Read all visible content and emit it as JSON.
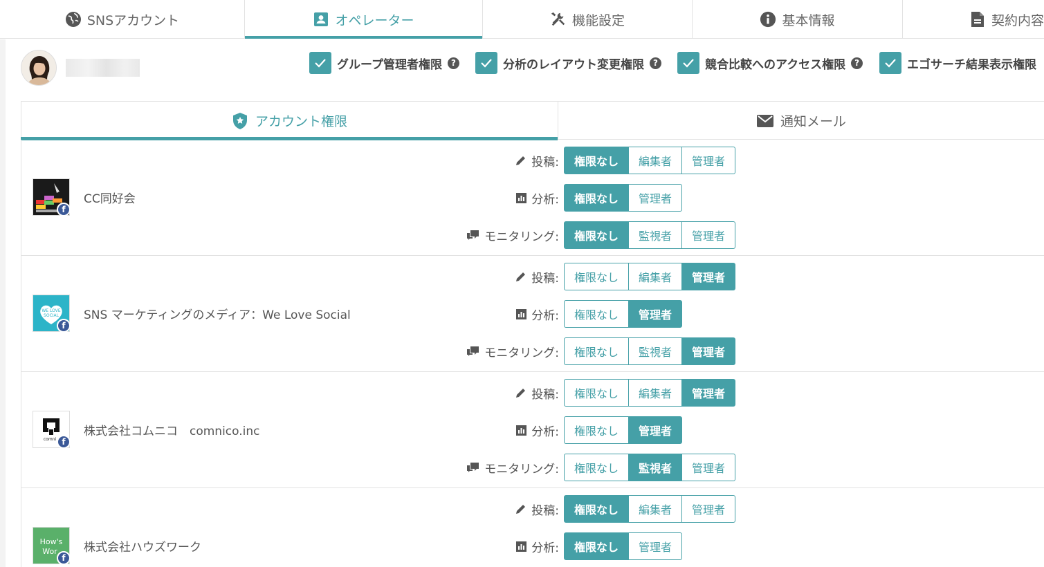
{
  "top_tabs": [
    {
      "label": "SNSアカウント",
      "icon": "globe-icon",
      "active": false
    },
    {
      "label": "オペレーター",
      "icon": "operator-id-icon",
      "active": true
    },
    {
      "label": "機能設定",
      "icon": "tools-icon",
      "active": false
    },
    {
      "label": "基本情報",
      "icon": "info-icon",
      "active": false
    },
    {
      "label": "契約内容",
      "icon": "document-icon",
      "active": false
    }
  ],
  "user": {
    "avatar": "avatar"
  },
  "permissions": [
    {
      "label": "グループ管理者権限",
      "checked": true
    },
    {
      "label": "分析のレイアウト変更権限",
      "checked": true
    },
    {
      "label": "競合比較へのアクセス権限",
      "checked": true
    },
    {
      "label": "エゴサーチ結果表示権限",
      "checked": true
    }
  ],
  "help_mark": "?",
  "inner_tabs": [
    {
      "label": "アカウント権限",
      "icon": "shield-icon",
      "active": true
    },
    {
      "label": "通知メール",
      "icon": "mail-icon",
      "active": false
    }
  ],
  "labels": {
    "post": "投稿:",
    "analysis": "分析:",
    "monitoring": "モニタリング:"
  },
  "options": {
    "none": "権限なし",
    "editor": "編集者",
    "admin": "管理者",
    "monitor": "監視者"
  },
  "accounts": [
    {
      "name": "CC同好会",
      "network": "f",
      "post": "none",
      "analysis": "none",
      "monitoring": "none"
    },
    {
      "name": "SNS マーケティングのメディア：We Love Social",
      "network": "f",
      "post": "admin",
      "analysis": "admin",
      "monitoring": "admin"
    },
    {
      "name": "株式会社コムニコ　comnico.inc",
      "network": "f",
      "post": "admin",
      "analysis": "admin",
      "monitoring": "monitor"
    },
    {
      "name": "株式会社ハウズワーク",
      "network": "f",
      "post": "none",
      "analysis": "none"
    }
  ],
  "colors": {
    "accent": "#45a0a7",
    "facebook": "#3b5998"
  }
}
